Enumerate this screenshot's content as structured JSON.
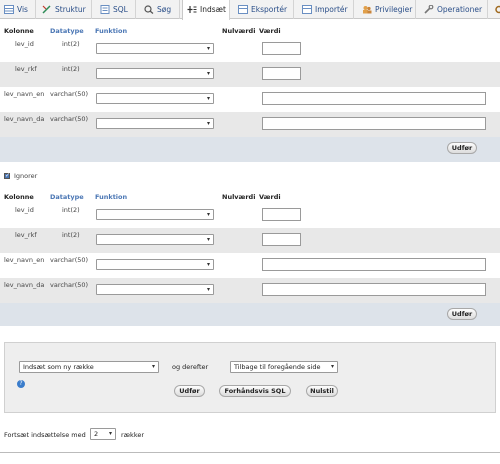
{
  "tabs": [
    {
      "label": "Vis",
      "icon": "table-icon",
      "active": false
    },
    {
      "label": "Struktur",
      "icon": "structure-icon",
      "active": false
    },
    {
      "label": "SQL",
      "icon": "sql-icon",
      "active": false
    },
    {
      "label": "Søg",
      "icon": "search-icon",
      "active": false
    },
    {
      "label": "Indsæt",
      "icon": "insert-icon",
      "active": true
    },
    {
      "label": "Eksportér",
      "icon": "export-icon",
      "active": false
    },
    {
      "label": "Importér",
      "icon": "import-icon",
      "active": false
    },
    {
      "label": "Privilegier",
      "icon": "privileges-icon",
      "active": false
    },
    {
      "label": "Operationer",
      "icon": "operations-icon",
      "active": false
    }
  ],
  "columns": {
    "kolonne": "Kolonne",
    "datatype": "Datatype",
    "funktion": "Funktion",
    "nulvaerdi": "Nulværdi",
    "vaerdi": "Værdi"
  },
  "form1": {
    "rows": [
      {
        "name": "lev_id",
        "type": "int(2)"
      },
      {
        "name": "lev_rkf",
        "type": "int(2)"
      },
      {
        "name": "lev_navn_en",
        "type": "varchar(50)"
      },
      {
        "name": "lev_navn_da",
        "type": "varchar(50)"
      }
    ],
    "submit": "Udfør"
  },
  "ignore_label": "Ignorer",
  "form2": {
    "rows": [
      {
        "name": "lev_id",
        "type": "int(2)"
      },
      {
        "name": "lev_rkf",
        "type": "int(2)"
      },
      {
        "name": "lev_navn_en",
        "type": "varchar(50)"
      },
      {
        "name": "lev_navn_da",
        "type": "varchar(50)"
      }
    ],
    "submit": "Udfør"
  },
  "bottom": {
    "insert_mode": "Indsæt som ny række",
    "and_then": "og derefter",
    "after_action": "Tilbage til foregående side",
    "buttons": {
      "submit": "Udfør",
      "preview": "Forhåndsvis SQL",
      "reset": "Nulstil"
    }
  },
  "continue": {
    "prefix": "Fortsæt indsættelse med",
    "count": "2",
    "suffix": "rækker"
  },
  "colors": {
    "link": "#2a4e88",
    "header_accent": "#4a76b4",
    "footer_bg": "#dde3ea",
    "alt_row": "#e8e8e8"
  }
}
